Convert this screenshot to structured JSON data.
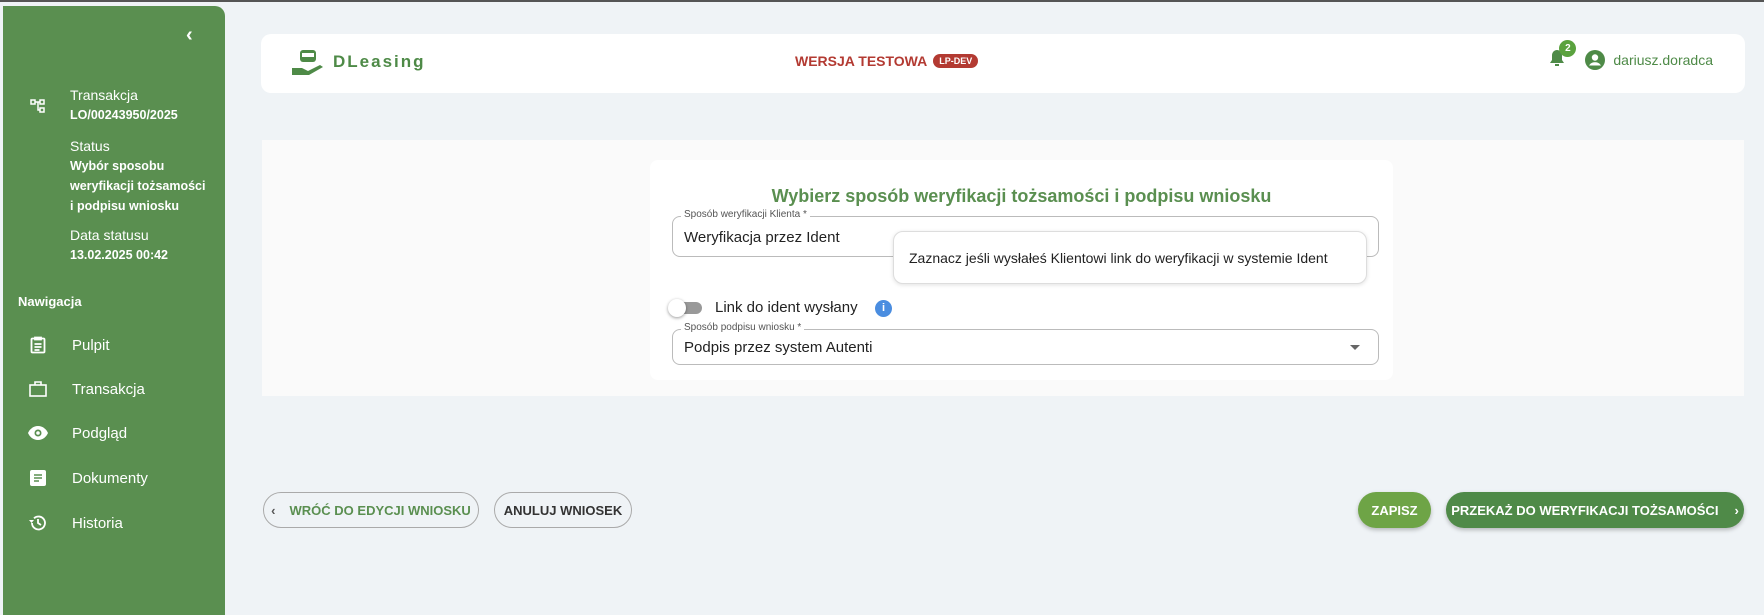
{
  "sidebar": {
    "collapse_icon": "chevron-left-icon",
    "transaction_label": "Transakcja",
    "transaction_value": "LO/00243950/2025",
    "status_label": "Status",
    "status_value_lines": [
      "Wybór sposobu",
      "weryfikacji tożsamości",
      "i podpisu wniosku"
    ],
    "status_date_label": "Data statusu",
    "status_date_value": "13.02.2025 00:42",
    "nav_heading": "Nawigacja",
    "items": [
      {
        "label": "Pulpit",
        "icon": "clipboard-icon"
      },
      {
        "label": "Transakcja",
        "icon": "briefcase-icon"
      },
      {
        "label": "Podgląd",
        "icon": "eye-icon"
      },
      {
        "label": "Dokumenty",
        "icon": "document-icon"
      },
      {
        "label": "Historia",
        "icon": "history-icon"
      }
    ],
    "color": "#5a8f50"
  },
  "header": {
    "logo_text": "DLeasing",
    "env_label": "WERSJA TESTOWA",
    "env_badge": "LP-DEV",
    "notification_count": "2",
    "username": "dariusz.doradca"
  },
  "form": {
    "title": "Wybierz sposób weryfikacji tożsamości i podpisu wniosku",
    "verification_label": "Sposób weryfikacji Klienta *",
    "verification_value": "Weryfikacja przez Ident",
    "tooltip": "Zaznacz jeśli wysłałeś Klientowi link do weryfikacji w systemie Ident",
    "toggle_label": "Link do ident wysłany",
    "toggle_on": false,
    "signature_label": "Sposób podpisu wniosku *",
    "signature_value": "Podpis przez system Autenti"
  },
  "actions": {
    "back": "WRÓĆ DO EDYCJI WNIOSKU",
    "cancel": "ANULUJ WNIOSEK",
    "save": "ZAPISZ",
    "submit": "PRZEKAŻ DO WERYFIKACJI TOŻSAMOŚCI"
  }
}
